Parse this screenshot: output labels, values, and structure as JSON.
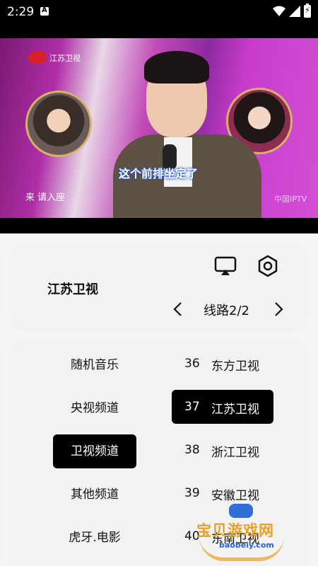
{
  "status_bar": {
    "time": "2:29",
    "notification_letter": "A"
  },
  "video": {
    "channel_logo_text": "江苏卫视",
    "subtitle": "这个前排坐定了",
    "caption": "来 请入座",
    "watermark": "中国IPTV"
  },
  "info": {
    "channel_name": "江苏卫视",
    "line_label": "线路2/2",
    "cast_icon": "cast-icon",
    "settings_icon": "settings-hex-icon"
  },
  "categories": [
    {
      "label": "随机音乐",
      "selected": false
    },
    {
      "label": "央视频道",
      "selected": false
    },
    {
      "label": "卫视频道",
      "selected": true
    },
    {
      "label": "其他频道",
      "selected": false
    },
    {
      "label": "虎牙.电影",
      "selected": false
    }
  ],
  "channels": [
    {
      "num": "36",
      "name": "东方卫视",
      "selected": false
    },
    {
      "num": "37",
      "name": "江苏卫视",
      "selected": true
    },
    {
      "num": "38",
      "name": "浙江卫视",
      "selected": false
    },
    {
      "num": "39",
      "name": "安徽卫视",
      "selected": false
    },
    {
      "num": "40",
      "name": "东南卫视",
      "selected": false
    }
  ],
  "site_watermark": {
    "title": "宝贝游戏网",
    "url": "baobeiy.com"
  }
}
